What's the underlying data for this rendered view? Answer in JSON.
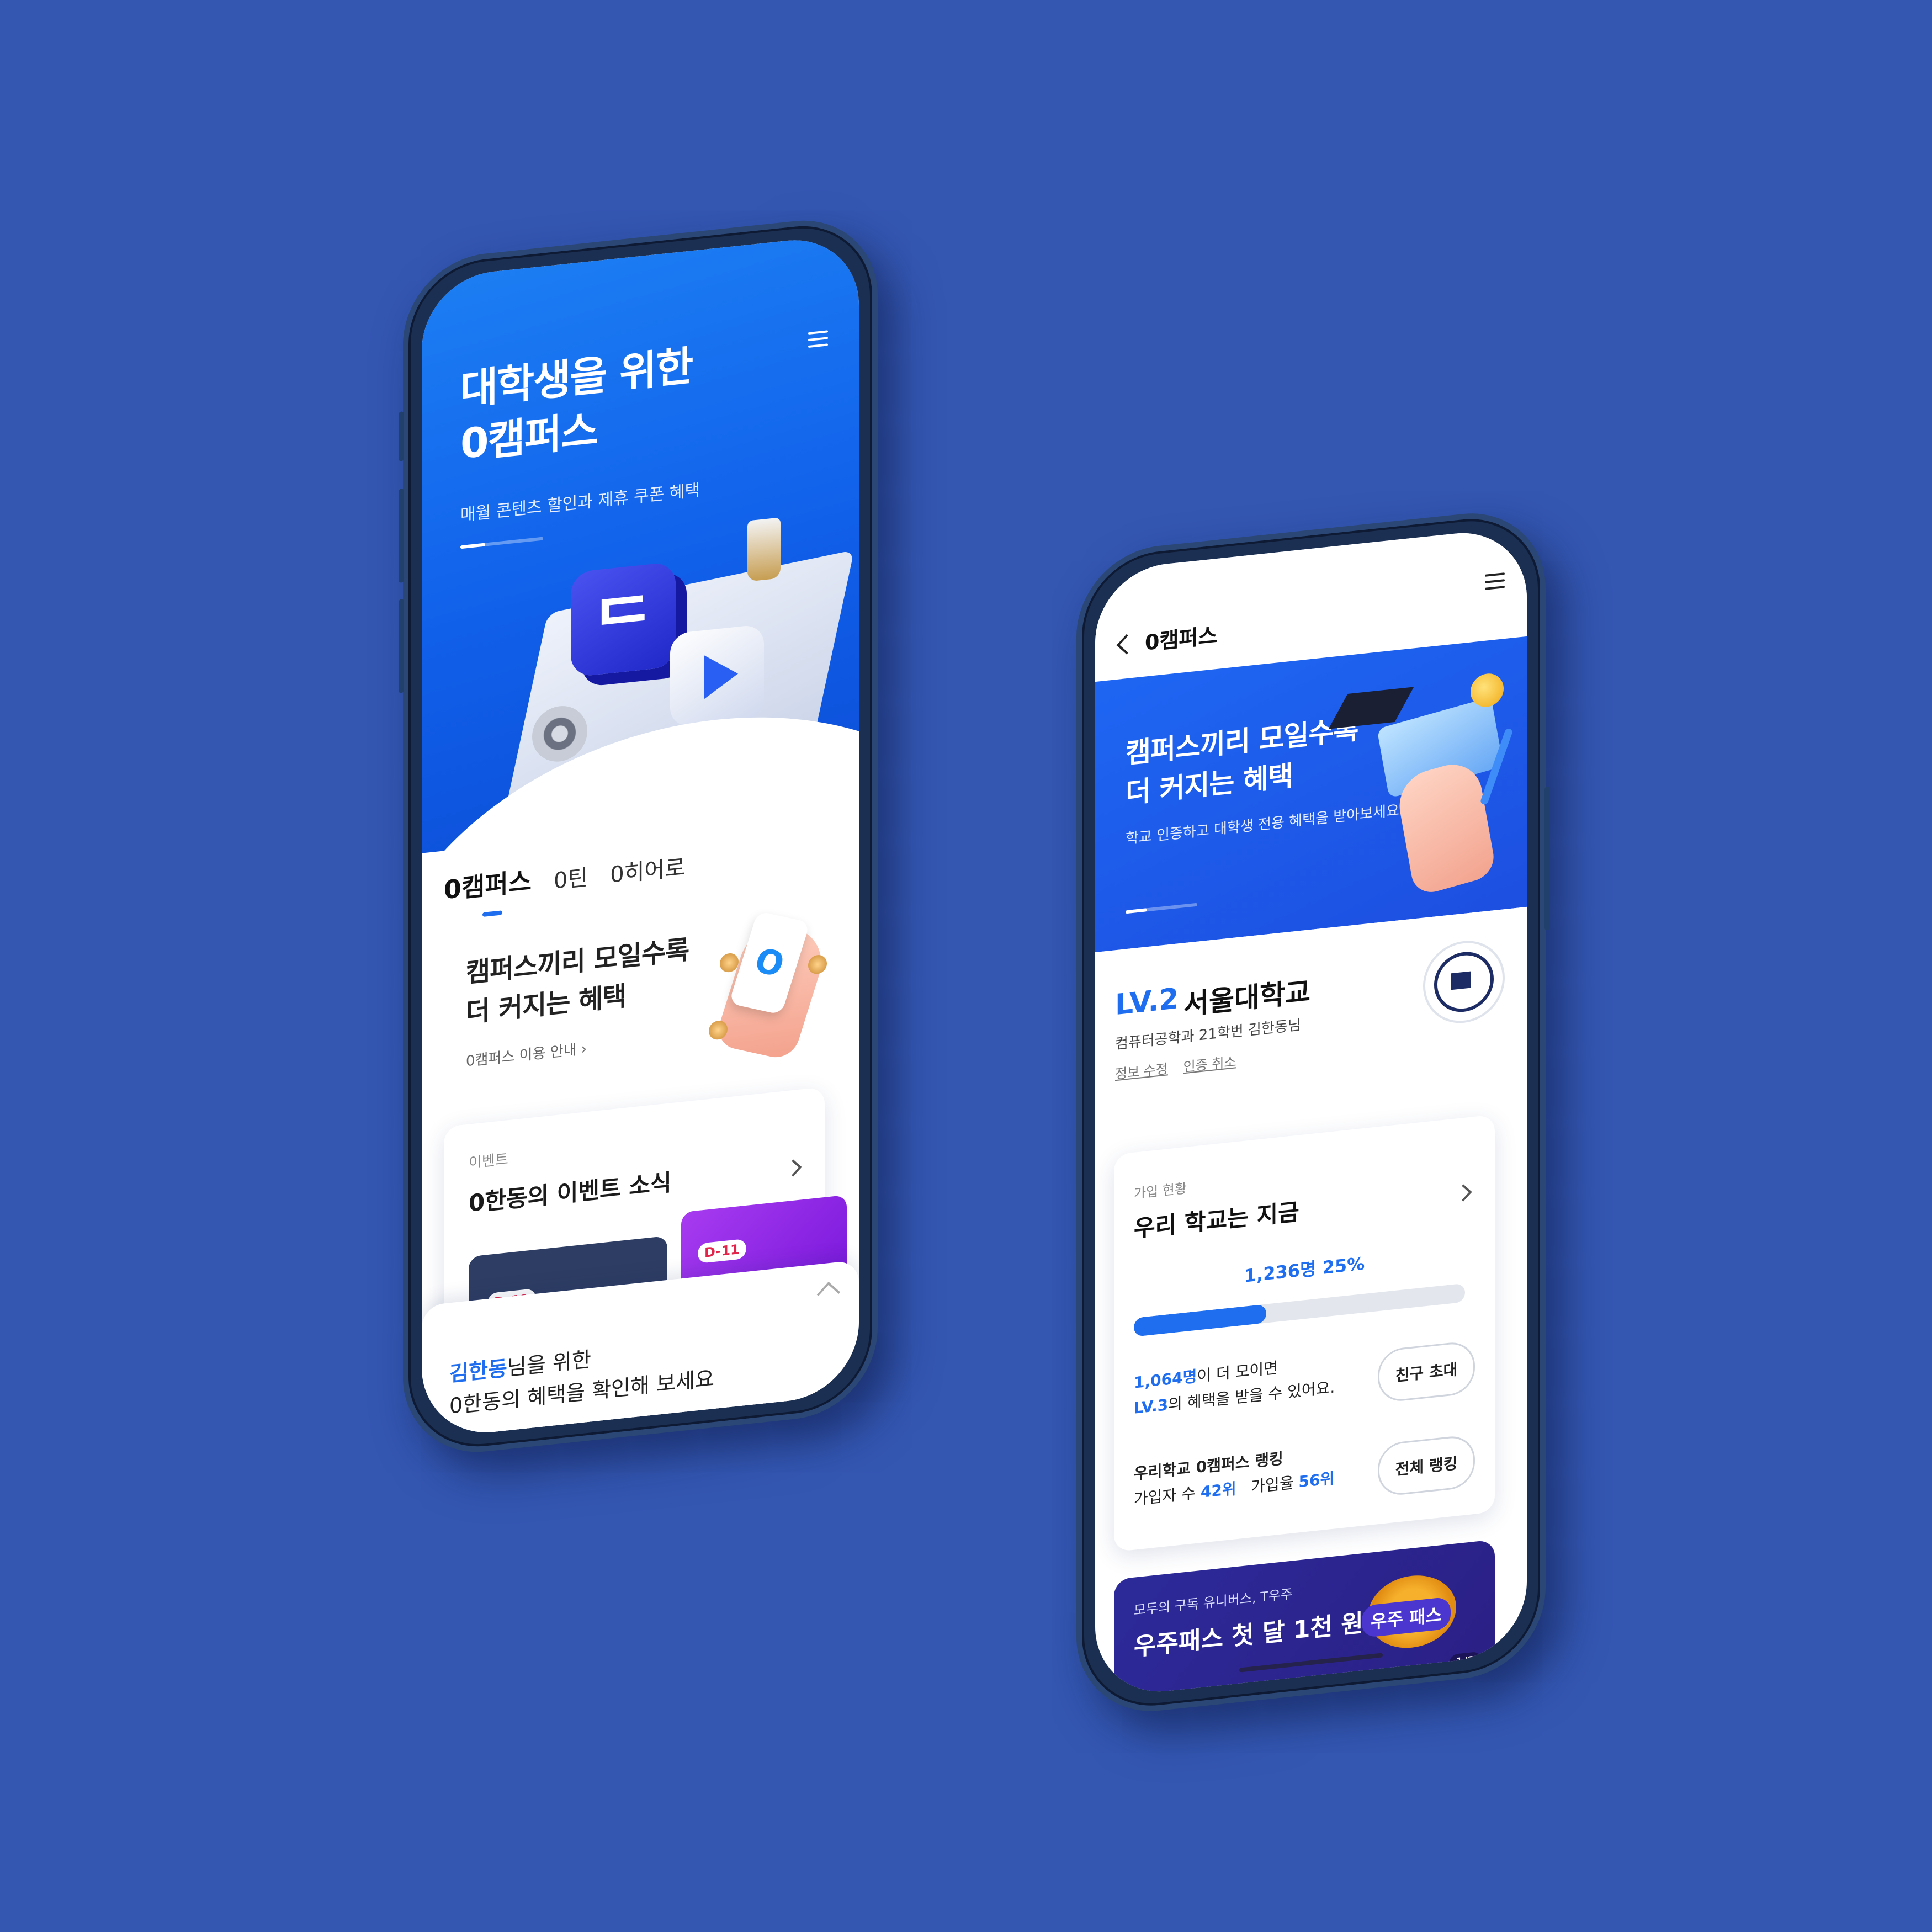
{
  "phone1": {
    "hero": {
      "title": "대학생을 위한\n0캠퍼스",
      "subtitle": "매월 콘텐츠 할인과 제휴 쿠폰 혜택",
      "slide_progress": 0.3
    },
    "tabs": [
      {
        "label": "0캠퍼스",
        "active": true
      },
      {
        "label": "0틴",
        "active": false
      },
      {
        "label": "0히어로",
        "active": false
      }
    ],
    "promo": {
      "title": "캠퍼스끼리 모일수록\n더 커지는 혜택",
      "link": "0캠퍼스 이용 안내"
    },
    "event_card": {
      "label": "이벤트",
      "title": "0한동의 이벤트 소식",
      "items": [
        {
          "badge": "D-11"
        },
        {
          "badge": "D-11"
        }
      ]
    },
    "bottom_sheet": {
      "name": "김한동",
      "line1_suffix": "님을 위한",
      "line2": "0한동의 혜택을 확인해 보세요"
    }
  },
  "phone2": {
    "nav": {
      "title": "0캠퍼스"
    },
    "hero": {
      "title": "캠퍼스끼리 모일수록\n더 커지는 혜택",
      "subtitle": "학교 인증하고 대학생 전용 혜택을 받아보세요",
      "slide_progress": 0.3
    },
    "profile": {
      "level": "LV.2",
      "school": "서울대학교",
      "department": "컴퓨터공학과 21학번 김한동님",
      "links": [
        "정보 수정",
        "인증 취소"
      ]
    },
    "status_card": {
      "label": "가입 현황",
      "title": "우리 학교는 지금",
      "count": "1,236명",
      "percent": "25%",
      "progress_value": 0.4,
      "remaining_count": "1,064명",
      "remaining_text_1": "이 더 모이면",
      "next_level": "LV.3",
      "remaining_text_2": "의 혜택을 받을 수 있어요.",
      "invite_button": "친구 초대",
      "ranking_title": "우리학교 0캠퍼스 랭킹",
      "ranking_members_label": "가입자 수",
      "ranking_members_value": "42위",
      "ranking_rate_label": "가입율",
      "ranking_rate_value": "56위",
      "ranking_button": "전체 랭킹"
    },
    "banner": {
      "small": "모두의 구독 유니버스, T우주",
      "big": "우주패스 첫 달 1천 원",
      "logo": "우주 패스",
      "page": "1/3"
    }
  },
  "colors": {
    "background": "#3457b2",
    "primary_blue": "#1f6ef0",
    "frame": "#1b2f52"
  }
}
